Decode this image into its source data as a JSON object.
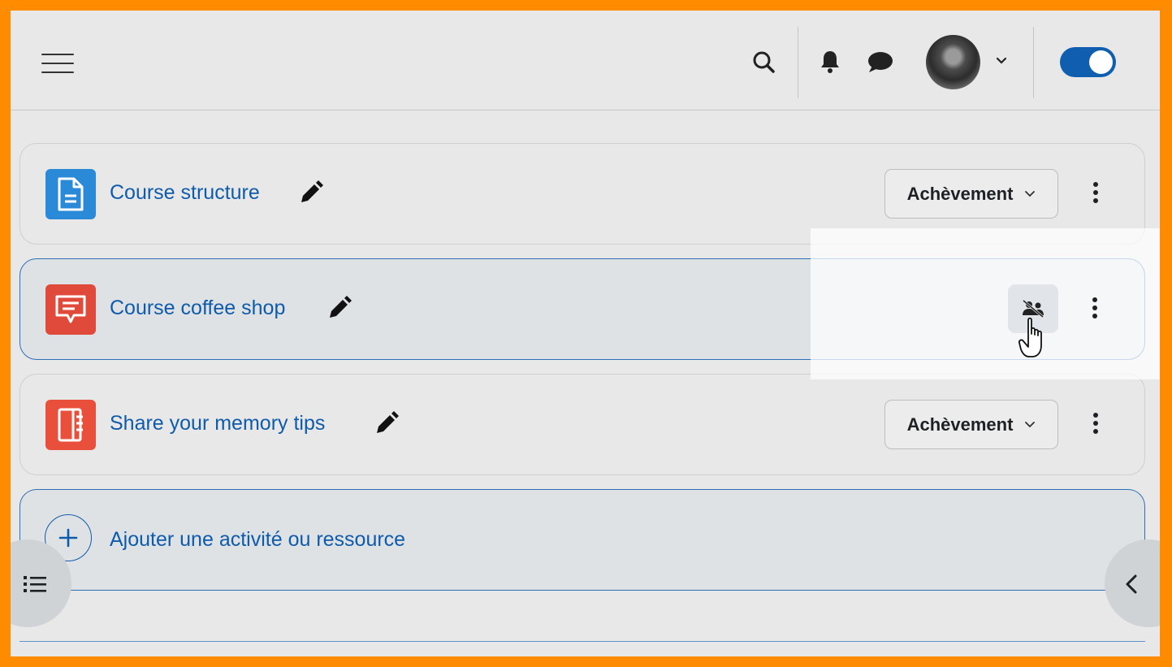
{
  "header": {
    "menu_icon": "hamburger-icon",
    "search_icon": "search-icon",
    "notifications_icon": "bell-icon",
    "messages_icon": "chat-bubble-icon",
    "user_menu_icon": "chevron-down-icon",
    "edit_mode_toggle": {
      "state": "on",
      "color": "#0f5eb0"
    }
  },
  "activities": [
    {
      "title": "Course structure",
      "icon": "page-icon",
      "icon_color": "#2b8ad8",
      "action": "Achèvement"
    },
    {
      "title": "Course coffee shop",
      "icon": "forum-icon",
      "icon_color": "#e04a3a",
      "action_icon": "group-mode-icon"
    },
    {
      "title": "Share your memory tips",
      "icon": "book-icon",
      "icon_color": "#e8503c",
      "action": "Achèvement"
    }
  ],
  "add_activity": {
    "label": "Ajouter une activité ou ressource",
    "icon": "plus-icon"
  },
  "colors": {
    "link": "#0f5bab",
    "accent_border": "#2f6fb6",
    "frame": "#ff8c00"
  }
}
